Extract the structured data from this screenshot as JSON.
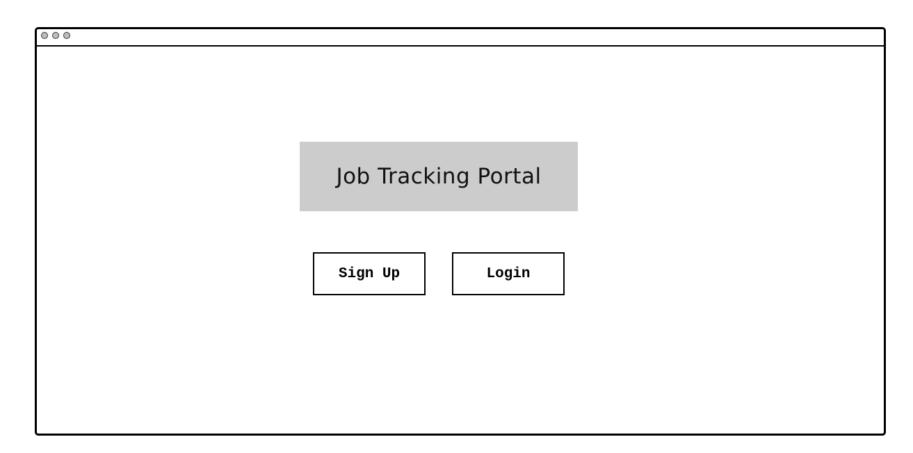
{
  "window": {
    "controls": [
      "window-dot-icon",
      "window-dot-icon",
      "window-dot-icon"
    ]
  },
  "main": {
    "title": "Job Tracking Portal",
    "buttons": {
      "signup_label": "Sign Up",
      "login_label": "Login"
    }
  },
  "colors": {
    "title_box_bg": "#cccccc",
    "border": "#000000",
    "background": "#ffffff"
  }
}
